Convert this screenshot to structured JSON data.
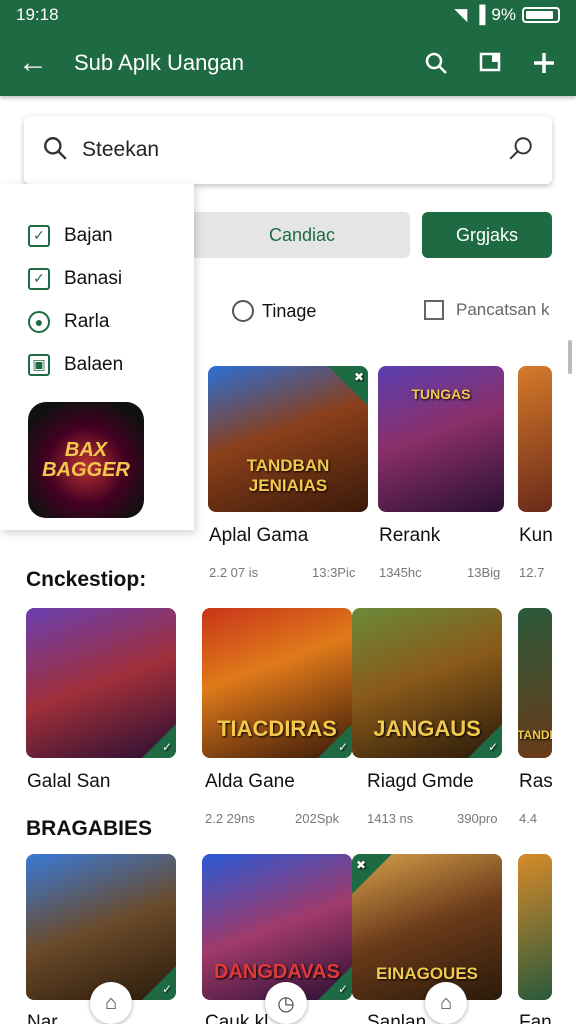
{
  "status": {
    "time": "19:18",
    "battery": "9%",
    "battery_level": 0.9
  },
  "appbar": {
    "title": "Sub Aplk Uangan"
  },
  "search": {
    "query": "Steekan"
  },
  "menu": {
    "items": [
      "Bajan",
      "Banasi",
      "Rarla",
      "Balaen"
    ]
  },
  "chips": [
    "Candiac",
    "Grgjaks"
  ],
  "filters": {
    "left": "Tinage",
    "right": "Pancatsan k"
  },
  "promo": {
    "art_text": "BAX BAGGER"
  },
  "row1": [
    {
      "name": "Aplal Gama",
      "meta_left": "2.2 07 is",
      "meta_right": "13:3Pic",
      "art": "TANDBAN JENIAIAS"
    },
    {
      "name": "Rerank",
      "meta_left": "1345hc",
      "meta_right": "13Big",
      "art": "TUNGAS"
    },
    {
      "name": "Kun",
      "meta_left": "12.7",
      "meta_right": "",
      "art": ""
    }
  ],
  "sections": [
    "Cnckestiop:",
    "BRAGABIES"
  ],
  "row2": [
    {
      "name": "Galal San",
      "meta_left": "",
      "meta_right": "",
      "art": ""
    },
    {
      "name": "Alda Gane",
      "meta_left": "2.2 29ns",
      "meta_right": "202Spk",
      "art": "TIACDIRAS"
    },
    {
      "name": "Riagd Gmde",
      "meta_left": "1413 ns",
      "meta_right": "390pro",
      "art": "JANGAUS"
    },
    {
      "name": "Ras",
      "meta_left": "4.4",
      "meta_right": "",
      "art": "TANDI"
    }
  ],
  "row3": [
    {
      "name": "Nar",
      "art": ""
    },
    {
      "name": "Cauk kl",
      "art": "DANGDAVAS"
    },
    {
      "name": "Sanlan",
      "art": "EINAGOUES"
    },
    {
      "name": "Fan",
      "art": ""
    }
  ],
  "icons": [
    "back-icon",
    "search-icon",
    "bookmark-icon",
    "add-icon",
    "magnifier-icon",
    "home-icon",
    "clock-icon"
  ],
  "colors": {
    "primary": "#1e6b43",
    "accent": "#f2c94c"
  }
}
